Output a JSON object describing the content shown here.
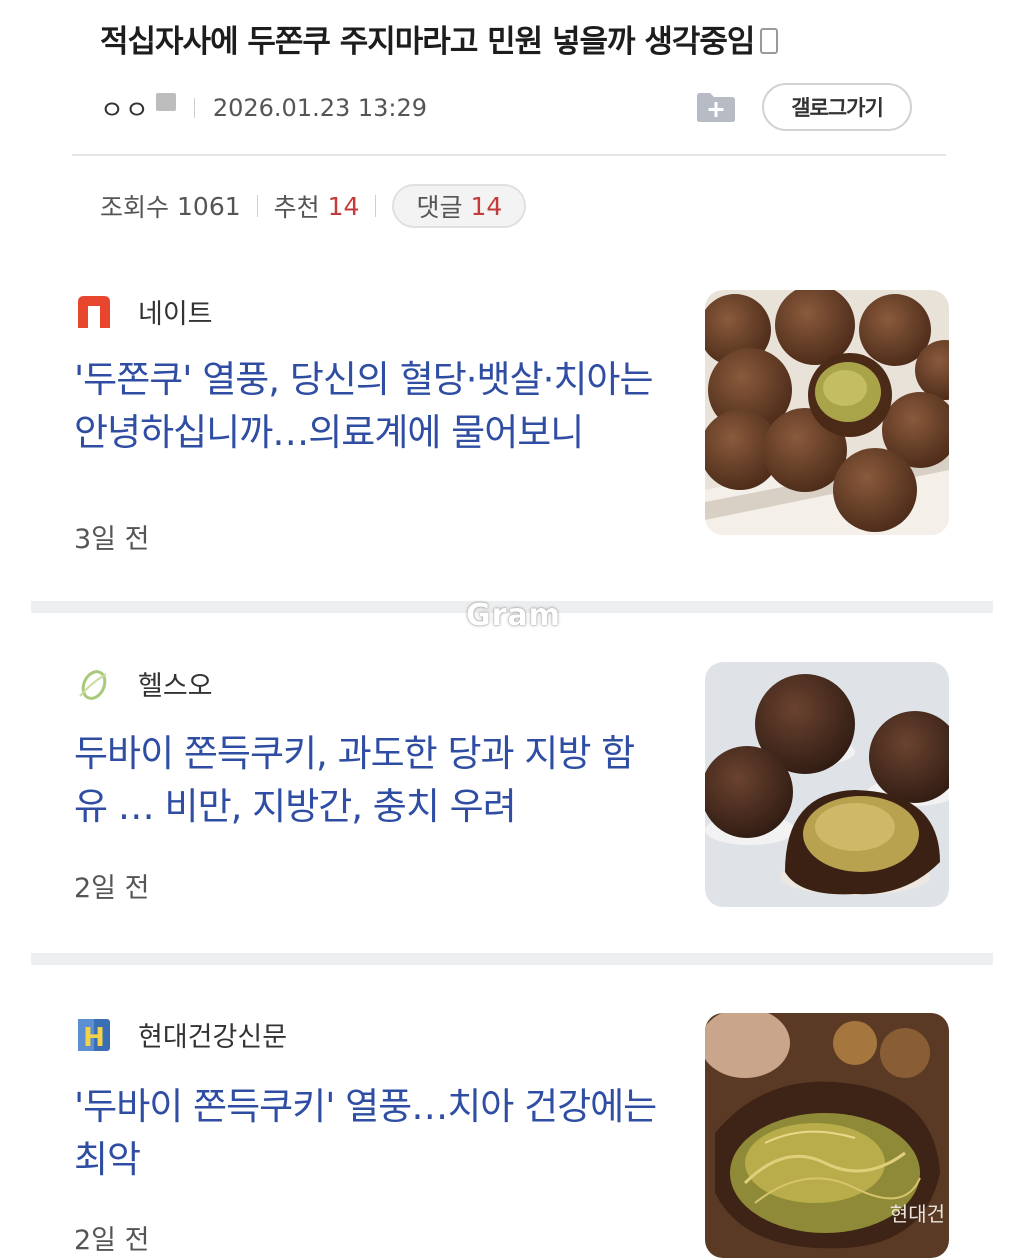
{
  "post": {
    "title": "적십자사에 두쫀쿠 주지마라고 민원 넣을까 생각중임",
    "author": "ㅇㅇ",
    "date": "2026.01.23 13:29",
    "gallery_button": "갤로그가기",
    "stats": {
      "views_label": "조회수",
      "views": "1061",
      "recommend_label": "추천",
      "recommend": "14",
      "comments_label": "댓글",
      "comments": "14"
    }
  },
  "watermark": "Gram",
  "news": [
    {
      "source": "네이트",
      "headline": "'두쫀쿠' 열풍, 당신의 혈당·뱃살·치아는 안녕하십니까…의료계에 물어보니",
      "time": "3일 전",
      "thumb_icon": "chocolate-truffle-image"
    },
    {
      "source": "헬스오",
      "headline": "두바이 쫀득쿠키, 과도한 당과 지방 함유 … 비만, 지방간, 충치 우려",
      "time": "2일 전",
      "thumb_icon": "dubai-cookie-image"
    },
    {
      "source": "현대건강신문",
      "headline": "'두바이 쫀득쿠키' 열풍…치아 건강에는 최악",
      "time": "2일 전",
      "thumb_icon": "pistachio-filling-image",
      "thumb_caption": "현대건"
    }
  ],
  "colors": {
    "headline": "#2f4ea3",
    "stat_accent": "#c43b3b",
    "divider": "#eceef0"
  }
}
